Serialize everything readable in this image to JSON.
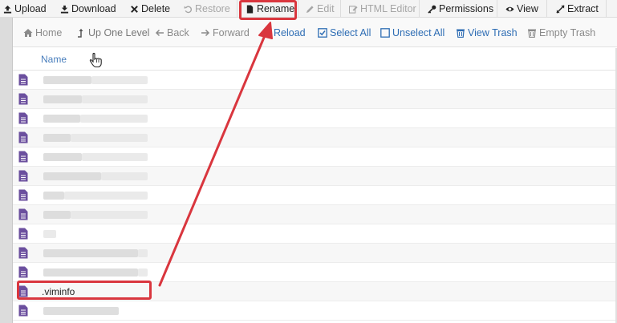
{
  "toolbar": {
    "upload": "Upload",
    "download": "Download",
    "delete": "Delete",
    "restore": "Restore",
    "rename": "Rename",
    "edit": "Edit",
    "html_editor": "HTML Editor",
    "permissions": "Permissions",
    "view": "View",
    "extract": "Extract"
  },
  "navbar": {
    "home": "Home",
    "up_one_level": "Up One Level",
    "back": "Back",
    "forward": "Forward",
    "reload": "Reload",
    "select_all": "Select All",
    "unselect_all": "Unselect All",
    "view_trash": "View Trash",
    "empty_trash": "Empty Trash"
  },
  "list": {
    "name_header": "Name",
    "rows": [
      {
        "name": ""
      },
      {
        "name": ""
      },
      {
        "name": ""
      },
      {
        "name": ""
      },
      {
        "name": ""
      },
      {
        "name": ""
      },
      {
        "name": ""
      },
      {
        "name": ""
      },
      {
        "name": ""
      },
      {
        "name": ""
      },
      {
        "name": ""
      },
      {
        "name": ".viminfo"
      },
      {
        "name": ""
      }
    ]
  },
  "colors": {
    "annotation_red": "#d9363e",
    "link_blue": "#2e6db4",
    "file_icon_purple": "#6b4f9e"
  }
}
